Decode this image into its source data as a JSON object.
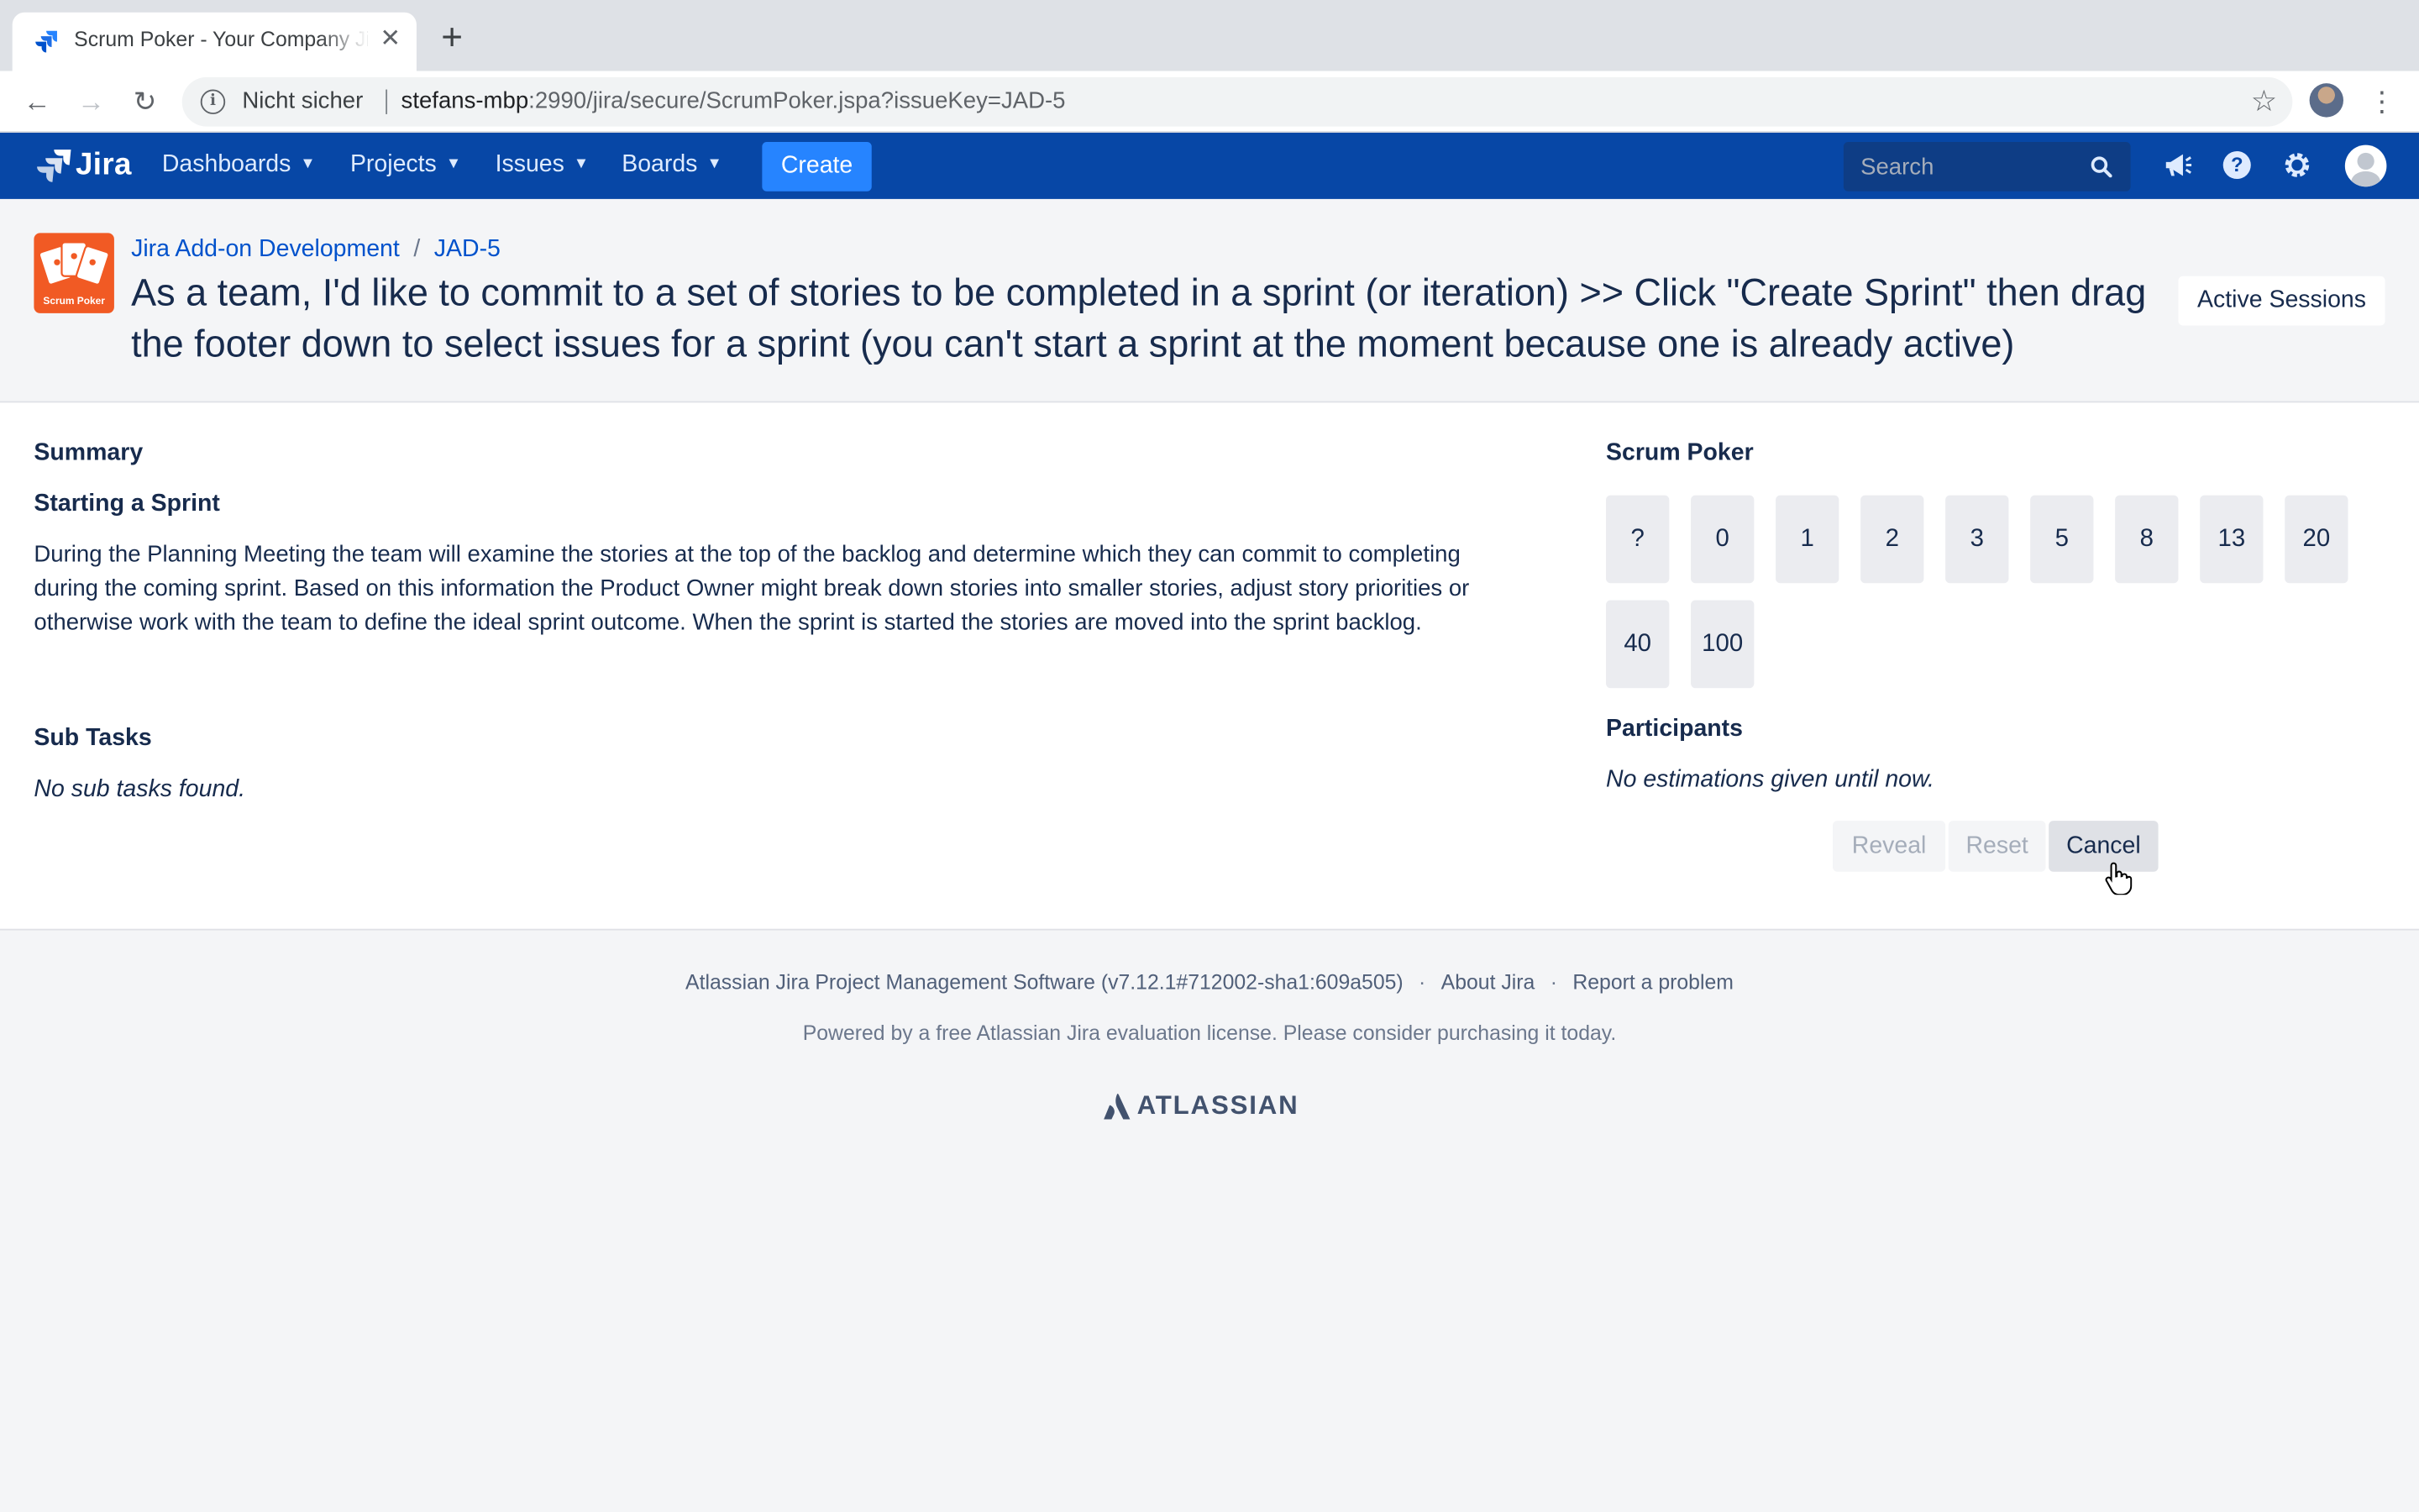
{
  "browser": {
    "tab_title": "Scrum Poker - Your Company Jira",
    "insecure_label": "Nicht sicher",
    "url_host": "stefans-mbp",
    "url_path": ":2990/jira/secure/ScrumPoker.jspa?issueKey=JAD-5"
  },
  "header": {
    "logo_text": "Jira",
    "menus": [
      "Dashboards",
      "Projects",
      "Issues",
      "Boards"
    ],
    "create_label": "Create",
    "search_placeholder": "Search",
    "brand_color": "#0747a6"
  },
  "issue": {
    "project_name": "Jira Add-on Development",
    "issue_key": "JAD-5",
    "project_avatar_text": "Scrum Poker",
    "title": "As a team, I'd like to commit to a set of stories to be completed in a sprint (or iteration) >> Click \"Create Sprint\" then drag the footer down to select issues for a sprint (you can't start a sprint at the moment because one is already active)",
    "active_sessions_label": "Active Sessions"
  },
  "summary": {
    "heading": "Summary",
    "subheading": "Starting a Sprint",
    "description": "During the Planning Meeting the team will examine the stories at the top of the backlog and determine which they can commit to completing during the coming sprint. Based on this information the Product Owner might break down stories into smaller stories, adjust story priorities or otherwise work with the team to define the ideal sprint outcome. When the sprint is started the stories are moved into the sprint backlog.",
    "subtasks_heading": "Sub Tasks",
    "subtasks_empty": "No sub tasks found."
  },
  "poker": {
    "heading": "Scrum Poker",
    "cards": [
      "?",
      "0",
      "1",
      "2",
      "3",
      "5",
      "8",
      "13",
      "20",
      "40",
      "100"
    ],
    "participants_heading": "Participants",
    "participants_empty": "No estimations given until now.",
    "reveal_label": "Reveal",
    "reset_label": "Reset",
    "cancel_label": "Cancel"
  },
  "footer": {
    "software": "Atlassian Jira Project Management Software (v7.12.1#712002-sha1:609a505)",
    "about": "About Jira",
    "report": "Report a problem",
    "license": "Powered by a free Atlassian Jira evaluation license. Please consider purchasing it today.",
    "brand": "ATLASSIAN"
  }
}
